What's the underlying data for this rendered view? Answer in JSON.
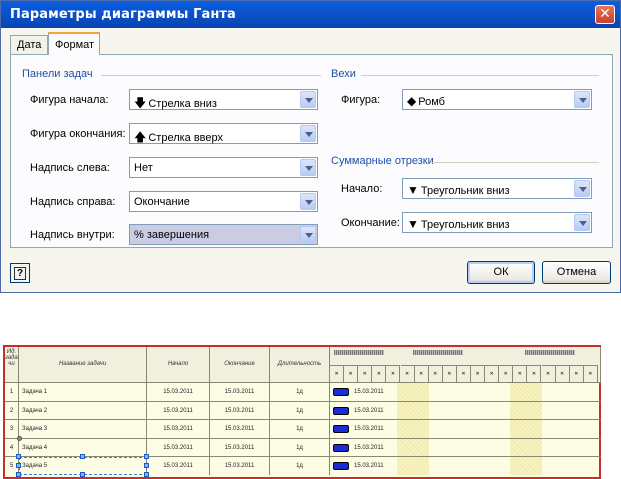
{
  "dialog": {
    "title": "Параметры диаграммы Ганта",
    "close_glyph": "✕",
    "tabs": [
      "Дата",
      "Формат"
    ],
    "active_tab": "Формат",
    "task_bars": {
      "group_title": "Панели задач",
      "fields": [
        {
          "label": "Фигура начала:",
          "glyph": "🡇",
          "glyph_name": "arrow-down-icon",
          "value": "Стрелка вниз"
        },
        {
          "label": "Фигура окончания:",
          "glyph": "🡅",
          "glyph_name": "arrow-up-icon",
          "value": "Стрелка вверх"
        },
        {
          "label": "Надпись слева:",
          "glyph": "",
          "value": "Нет"
        },
        {
          "label": "Надпись справа:",
          "glyph": "",
          "value": "Окончание"
        },
        {
          "label": "Надпись внутри:",
          "glyph": "",
          "value": "% завершения"
        }
      ]
    },
    "milestones": {
      "group_title": "Вехи",
      "field": {
        "label": "Фигура:",
        "glyph": "◆",
        "glyph_name": "diamond-icon",
        "value": "Ромб"
      }
    },
    "summary": {
      "group_title": "Суммарные отрезки",
      "fields": [
        {
          "label": "Начало:",
          "glyph": "▼",
          "glyph_name": "triangle-down-icon",
          "value": "Треугольник вниз"
        },
        {
          "label": "Окончание:",
          "glyph": "▼",
          "glyph_name": "triangle-down-icon",
          "value": "Треугольник вниз"
        }
      ]
    },
    "help_glyph": "?",
    "buttons": {
      "ok": "ОК",
      "cancel": "Отмена"
    },
    "colors": {
      "titlebar": "#0b52c9",
      "group_title": "#1f4fa8",
      "selected_field": "#cbcbe3"
    }
  },
  "gantt": {
    "headers": {
      "id": "Ид. зада-чи",
      "name": "Название задачи",
      "start": "Начало",
      "finish": "Окончание",
      "duration": "Длительность"
    },
    "tasks": [
      {
        "id": "1",
        "name": "Задача 1",
        "start": "15.03.2011",
        "finish": "15.03.2011",
        "duration": "1д",
        "bar_label": "15.03.2011"
      },
      {
        "id": "2",
        "name": "Задача 2",
        "start": "15.03.2011",
        "finish": "15.03.2011",
        "duration": "1д",
        "bar_label": "15.03.2011"
      },
      {
        "id": "3",
        "name": "Задача 3",
        "start": "15.03.2011",
        "finish": "15.03.2011",
        "duration": "1д",
        "bar_label": "15.03.2011"
      },
      {
        "id": "4",
        "name": "Задача 4",
        "start": "15.03.2011",
        "finish": "15.03.2011",
        "duration": "1д",
        "bar_label": "15.03.2011"
      },
      {
        "id": "5",
        "name": "Задача 5",
        "start": "15.03.2011",
        "finish": "15.03.2011",
        "duration": "1д",
        "bar_label": "15.03.2011"
      }
    ],
    "day_marker": "✕",
    "colors": {
      "border": "#c62d2d",
      "bar": "#1b2bd5",
      "weekend": "#f7f3c2"
    }
  }
}
